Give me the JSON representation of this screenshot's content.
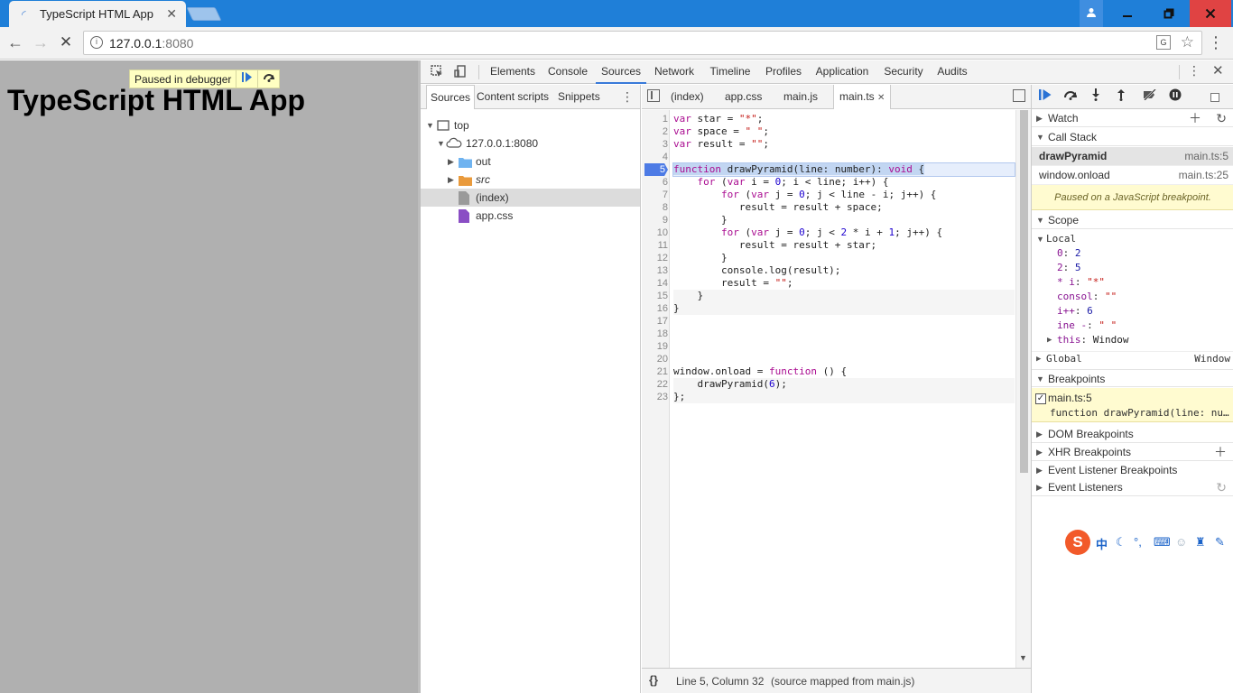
{
  "browser": {
    "tab_title": "TypeScript HTML App",
    "tab_close": "✕",
    "url_host": "127.0.0.1",
    "url_port": ":8080"
  },
  "page": {
    "heading": "TypeScript HTML App",
    "paused_text": "Paused in debugger"
  },
  "devtools": {
    "tabs": [
      "Elements",
      "Console",
      "Sources",
      "Network",
      "Timeline",
      "Profiles",
      "Application",
      "Security",
      "Audits"
    ],
    "active_tab": "Sources",
    "navigator": {
      "tabs": [
        "Sources",
        "Content scripts",
        "Snippets"
      ],
      "tree": [
        {
          "label": "top",
          "level": 0,
          "icon": "frame-icon",
          "expanded": true
        },
        {
          "label": "127.0.0.1:8080",
          "level": 1,
          "icon": "cloud-icon",
          "expanded": true
        },
        {
          "label": "out",
          "level": 2,
          "icon": "folder-icon",
          "expanded": false
        },
        {
          "label": "src",
          "level": 2,
          "icon": "folder-icon",
          "expanded": false
        },
        {
          "label": "(index)",
          "level": 2,
          "icon": "file-icon",
          "selected": true
        },
        {
          "label": "app.css",
          "level": 2,
          "icon": "file-icon"
        }
      ]
    },
    "editor": {
      "tabs": [
        "(index)",
        "app.css",
        "main.js",
        "main.ts"
      ],
      "active_tab": "main.ts",
      "active_tab_close": "✕",
      "breakpoint_line": 5,
      "status": {
        "cursor": "Line 5, Column 32",
        "mapped": "(source mapped from main.js)"
      }
    },
    "debugger": {
      "watch": "Watch",
      "call_stack": "Call Stack",
      "frames": [
        {
          "fn": "drawPyramid",
          "loc": "main.ts:5"
        },
        {
          "fn": "window.onload",
          "loc": "main.ts:25"
        }
      ],
      "paused_msg": "Paused on a JavaScript breakpoint.",
      "scope": "Scope",
      "local": "Local",
      "scope_vars": [
        {
          "name": "0",
          "value": "2",
          "type": "num"
        },
        {
          "name": "2",
          "value": "5",
          "type": "num"
        },
        {
          "name": "* i",
          "value": "\"*\"",
          "type": "str"
        },
        {
          "name": "consol",
          "value": "\"\"",
          "type": "str"
        },
        {
          "name": "i++",
          "value": "6",
          "type": "num"
        },
        {
          "name": "ine -",
          "value": "\" \"",
          "type": "str"
        },
        {
          "name": "this",
          "value": "Window",
          "type": "obj"
        }
      ],
      "global": "Global",
      "global_value": "Window",
      "breakpoints": "Breakpoints",
      "bp_location": "main.ts:5",
      "bp_code": "function drawPyramid(line: nu…",
      "dom_breakpoints": "DOM Breakpoints",
      "xhr_breakpoints": "XHR Breakpoints",
      "event_listener_breakpoints": "Event Listener Breakpoints",
      "event_listeners": "Event Listeners"
    }
  },
  "ime": {
    "logo": "S",
    "mode": "中"
  }
}
